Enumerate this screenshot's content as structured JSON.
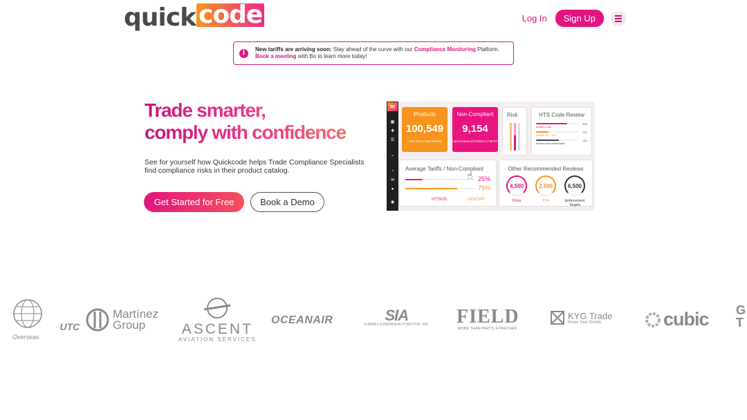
{
  "header": {
    "logo_left": "quick",
    "logo_right": "code",
    "login_label": "Log In",
    "signup_label": "Sign Up"
  },
  "banner": {
    "bold": "New tariffs are arriving soon:",
    "text1": " Stay ahead of the curve with our ",
    "link1": "Compliance Monitoring",
    "text2": " Platform. ",
    "link2": "Book a meeting",
    "text3": " with Bo to learn more today!"
  },
  "hero": {
    "title_line1": "Trade smarter,",
    "title_line2": "comply with confidence",
    "subtitle": "See for yourself how Quickcode helps Trade Compliance Specialists find compliance risks in their product catalog.",
    "primary_cta": "Get Started for Free",
    "secondary_cta": "Book a Demo"
  },
  "dashboard": {
    "logo": "qc",
    "products_label": "Products",
    "products_value": "100,549",
    "products_note": "+427 Since Last Review",
    "noncompliant_label": "Non-Compliant",
    "noncompliant_value": "9,154",
    "noncompliant_note": "Last Review 5/17/2024 17:08 ET",
    "risk_label": "Risk",
    "hts_label": "HTS Code Review",
    "hts_rows": [
      {
        "label": "Invalid Code",
        "value": "626",
        "fill": 0.75,
        "color": "#e3147f"
      },
      {
        "label": "Invalid 301, 232",
        "value": "237",
        "fill": 0.3,
        "color": "#f7941d"
      },
      {
        "label": "Review Recommended",
        "value": "322",
        "fill": 0.55,
        "color": "#444444"
      }
    ],
    "avg_label": "Average Tariffs / Non-Compliant",
    "avg_pct1": "25%",
    "avg_pct2": "75%",
    "avg_fill1": 0.25,
    "avg_fill2": 0.75,
    "avg_col1": "HTSUS",
    "avg_col2": "AD/CVD",
    "orr_label": "Other Recommended Reviews",
    "rings": [
      {
        "value": "4,500",
        "label": "PGAs",
        "color": "#e3147f"
      },
      {
        "value": "2,500",
        "label": "FTA",
        "color": "#f7941d"
      },
      {
        "value": "6,500",
        "label": "Enforcement Targets",
        "color": "#333333"
      }
    ]
  },
  "logos": {
    "utc_main": "UTC",
    "utc_sub": "Overseas",
    "martinez_1": "Martínez",
    "martinez_2": "Group",
    "ascent_main": "ASCENT",
    "ascent_sub": "AVIATION SERVICES",
    "oceanair": "OCEANAIR",
    "sia_main": "SIA",
    "sia_sub": "SUBARU of INDIANA AUTOMOTIVE, INC.",
    "field_main": "FIELD",
    "field_sub": "MORE THAN PARTS. A PARTNER.",
    "kyg_main": "KYG Trade",
    "kyg_sub": "Know Your Goods",
    "cubic": "cubic",
    "gt": "G T"
  },
  "colors": {
    "brand_pink": "#e3147f",
    "brand_orange": "#f7941d"
  }
}
